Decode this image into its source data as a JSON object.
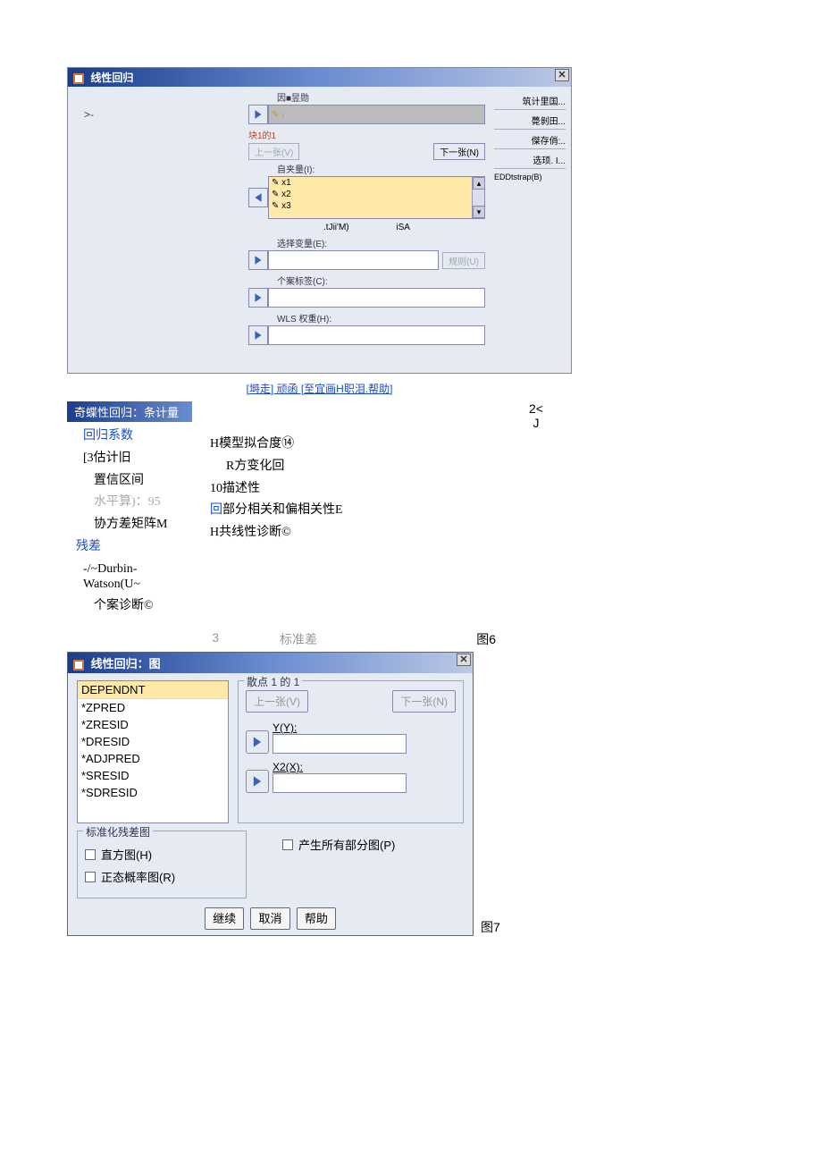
{
  "dlg1": {
    "title": "线性回归",
    "leftmarker": ">-",
    "dep_label": "因■昱勋",
    "dep_value": "y",
    "block_label": "块1的1",
    "prev": "上一张(V)",
    "next": "下一张(N)",
    "indep_label": "自夹量(I):",
    "indeps": [
      "x1",
      "x2",
      "x3"
    ],
    "below_left": ".tJii'M)",
    "below_right": "iSA",
    "select_label": "选择变量(E):",
    "rule_btn": "规则(U)",
    "case_label": "个案标签(C):",
    "wls_label": "WLS 权重(H):",
    "footer": "[塒走] 顽函 [至宜画H职泪.帮助]",
    "right": {
      "r1": "筑计里国...",
      "r2": "薨剝田...",
      "r3": "傑存俏:..",
      "r4": "选顼. I...",
      "r5": "EDDtstrap(B)"
    }
  },
  "mid": {
    "title": "奇蝶性回归：条计量",
    "c1_a": "回归系数",
    "c1_b": "[3估计旧",
    "c1_c": "置信区间",
    "c1_d": "水平算)：95",
    "c1_e": "协方差矩阵M",
    "c1_f": "残差",
    "c1_g": "-/~Durbin-Watson(U~",
    "c1_h": "个案诊断©",
    "top_x": "2<",
    "top_j": "J",
    "c2_a": "H模型拟合度⑭",
    "c2_b": "R方变化回",
    "c2_c": "10描述性",
    "c2_d": "回部分相关和偏相关性E",
    "c2_e": "H共线性诊断©",
    "bot_left": "3",
    "bot_mid": "标准差",
    "fig6": "图6"
  },
  "dlg2": {
    "title": "线性回归：图",
    "list": [
      "DEPENDNT",
      "*ZPRED",
      "*ZRESID",
      "*DRESID",
      "*ADJPRED",
      "*SRESID",
      "*SDRESID"
    ],
    "frame1": "散点 1 的 1",
    "prev": "上一张(V)",
    "next": "下一张(N)",
    "ylabel": "Y(Y):",
    "xlabel": "X2(X):",
    "frame2": "标准化残差图",
    "cb1": "直方图(H)",
    "cb2": "正态概率图(R)",
    "allparts": "产生所有部分图(P)",
    "b1": "继续",
    "b2": "取消",
    "b3": "帮助",
    "fig7": "图7"
  }
}
